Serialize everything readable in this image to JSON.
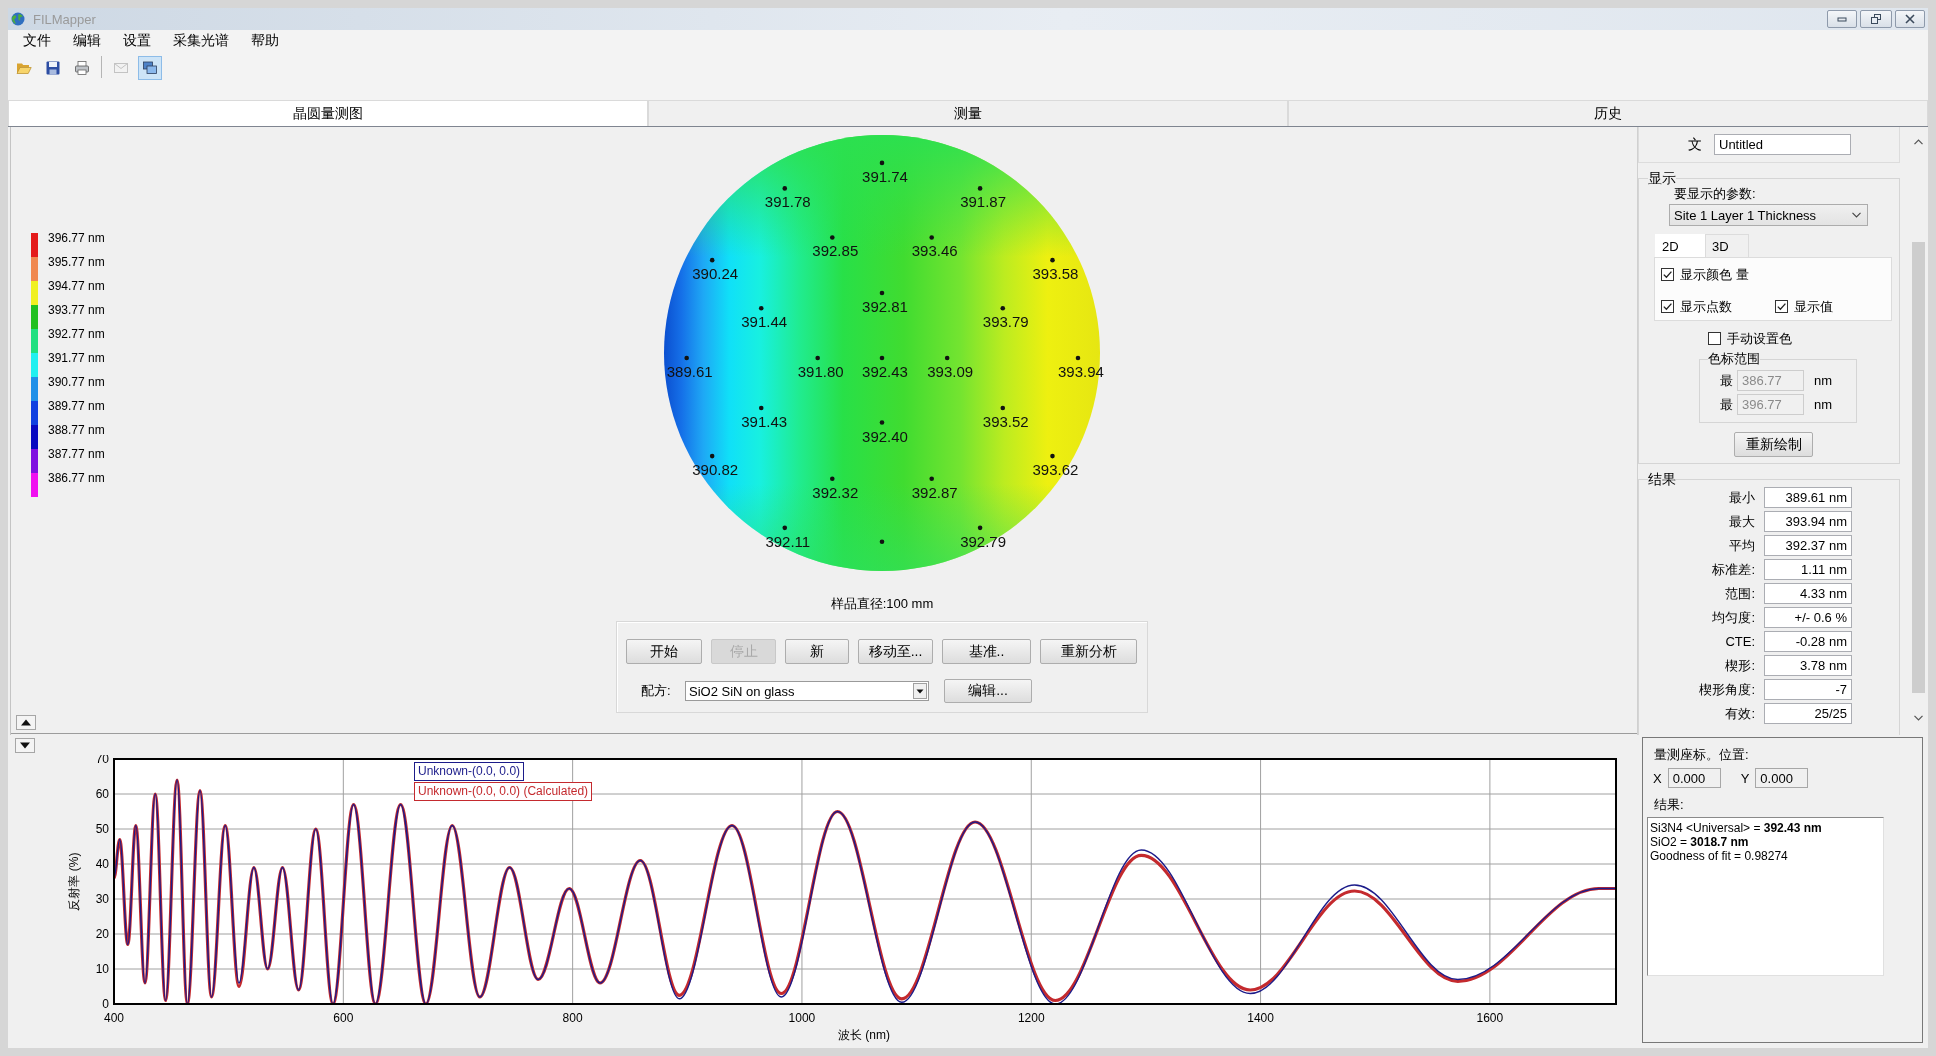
{
  "window": {
    "title": "FILMapper"
  },
  "menu": [
    "文件",
    "编辑",
    "设置",
    "采集光谱",
    "帮助"
  ],
  "toolbar": {
    "groups": [
      [
        {
          "disabled": false,
          "pressed": false
        },
        {
          "disabled": false,
          "pressed": false
        },
        {
          "disabled": false,
          "pressed": false
        }
      ],
      [
        {
          "disabled": true,
          "pressed": false
        },
        {
          "disabled": false,
          "pressed": true
        }
      ]
    ]
  },
  "tabs": [
    {
      "label": "晶圆量测图",
      "selected": true
    },
    {
      "label": "测量",
      "selected": false
    },
    {
      "label": "历史",
      "selected": false
    }
  ],
  "wafer_map": {
    "legend": [
      {
        "label": "396.77 nm",
        "color": "#e41a1a"
      },
      {
        "label": "395.77 nm",
        "color": "#f08850"
      },
      {
        "label": "394.77 nm",
        "color": "#f0f020"
      },
      {
        "label": "393.77 nm",
        "color": "#20c020"
      },
      {
        "label": "392.77 nm",
        "color": "#20e080"
      },
      {
        "label": "391.77 nm",
        "color": "#20f0f0"
      },
      {
        "label": "390.77 nm",
        "color": "#2090e8"
      },
      {
        "label": "389.77 nm",
        "color": "#1040e0"
      },
      {
        "label": "388.77 nm",
        "color": "#0808c0"
      },
      {
        "label": "387.77 nm",
        "color": "#8010e0"
      },
      {
        "label": "386.77 nm",
        "color": "#f010f0"
      }
    ],
    "sites": [
      {
        "kind": "labeled",
        "value": "391.74"
      },
      {
        "kind": "labeled",
        "value": "391.78"
      },
      {
        "kind": "labeled",
        "value": "391.87"
      },
      {
        "kind": "labeled",
        "value": "392.85"
      },
      {
        "kind": "labeled",
        "value": "393.46"
      },
      {
        "kind": "labeled",
        "value": "390.24"
      },
      {
        "kind": "labeled",
        "value": "393.58"
      },
      {
        "kind": "labeled",
        "value": "392.81"
      },
      {
        "kind": "labeled",
        "value": "391.44"
      },
      {
        "kind": "labeled",
        "value": "393.79"
      },
      {
        "kind": "labeled",
        "value": "389.61"
      },
      {
        "kind": "labeled",
        "value": "391.80"
      },
      {
        "kind": "labeled",
        "value": "392.43"
      },
      {
        "kind": "labeled",
        "value": "393.09"
      },
      {
        "kind": "labeled",
        "value": "393.94"
      },
      {
        "kind": "labeled",
        "value": "391.43"
      },
      {
        "kind": "labeled",
        "value": "393.52"
      },
      {
        "kind": "labeled",
        "value": "392.40"
      },
      {
        "kind": "labeled",
        "value": "390.82"
      },
      {
        "kind": "labeled",
        "value": "393.62"
      },
      {
        "kind": "labeled",
        "value": "392.32"
      },
      {
        "kind": "labeled",
        "value": "392.87"
      },
      {
        "kind": "labeled",
        "value": "392.11"
      },
      {
        "kind": "unlabeled"
      },
      {
        "kind": "labeled",
        "value": "392.79"
      }
    ],
    "diameter": "样品直径:100 mm",
    "buttons": [
      {
        "label": "开始",
        "disabled": false
      },
      {
        "label": "停止",
        "disabled": true
      },
      {
        "label": "新",
        "disabled": false
      },
      {
        "label": "移动至...",
        "disabled": false
      },
      {
        "label": "基准..",
        "disabled": false
      },
      {
        "label": "重新分析",
        "disabled": false
      }
    ],
    "recipe": {
      "label": "配方:",
      "value": "SiO2 SiN on glass"
    },
    "edit_button": "编辑..."
  },
  "properties": {
    "document": {
      "label": "文",
      "value": "Untitled"
    },
    "display": {
      "title": "显示",
      "param_label": "要显示的参数:",
      "param_value": "Site 1 Layer 1 Thickness",
      "view_tabs": [
        {
          "label": "2D",
          "selected": true
        },
        {
          "label": "3D",
          "selected": false
        }
      ],
      "options": [
        {
          "label": "显示颜色 量",
          "checked": true
        },
        {
          "label": "显示点数",
          "checked": true
        },
        {
          "label": "显示值",
          "checked": true
        }
      ],
      "manual_color": {
        "label": "手动设置色",
        "checked": false
      },
      "color_range": {
        "title": "色标范围",
        "disabled": true,
        "rows": [
          {
            "label": "最",
            "value": "386.77",
            "unit": "nm"
          },
          {
            "label": "最",
            "value": "396.77",
            "unit": "nm"
          }
        ]
      },
      "redraw_button": "重新绘制"
    },
    "results": {
      "title": "结果",
      "rows": [
        {
          "label": "最小",
          "value": "389.61 nm"
        },
        {
          "label": "最大",
          "value": "393.94 nm"
        },
        {
          "label": "平均",
          "value": "392.37 nm"
        },
        {
          "label": "标准差:",
          "value": "1.11 nm"
        },
        {
          "label": "范围:",
          "value": "4.33 nm"
        },
        {
          "label": "均匀度:",
          "value": "+/- 0.6 %"
        },
        {
          "label": "CTE:",
          "value": "-0.28 nm"
        },
        {
          "label": "楔形:",
          "value": "3.78 nm"
        },
        {
          "label": "楔形角度:",
          "value": "-7"
        },
        {
          "label": "有效:",
          "value": "25/25"
        }
      ]
    }
  },
  "spectrum": {
    "chart_data": {
      "type": "line",
      "xlabel": "波长 (nm)",
      "ylabel": "反射率 (%)",
      "x": [
        400,
        405,
        412,
        419,
        427,
        436,
        445,
        455,
        464,
        475,
        485,
        497,
        509,
        522,
        534,
        547,
        561,
        576,
        591,
        609,
        628,
        650,
        672,
        695,
        719,
        745,
        770,
        797,
        824,
        859,
        893,
        939,
        982,
        1031,
        1087,
        1151,
        1221,
        1296,
        1391,
        1482,
        1572,
        1695,
        1710
      ],
      "series": [
        {
          "name": "Unknown-(0.0, 0.0)",
          "color": "#1c1c8a",
          "values": [
            36,
            47,
            17,
            51,
            6,
            60,
            1,
            64,
            0,
            61,
            2,
            51,
            6,
            39,
            10,
            39,
            4,
            50,
            0,
            57,
            0,
            57,
            0,
            51,
            2,
            39,
            7,
            33,
            6,
            41,
            1.5,
            51,
            2,
            55,
            0.5,
            52,
            0,
            44,
            3,
            34,
            7,
            33,
            33
          ]
        },
        {
          "name": "Unknown-(0.0, 0.0) (Calculated)",
          "color": "#c42a2e",
          "values": [
            36,
            47,
            17,
            51,
            6,
            60,
            1,
            64,
            0,
            61,
            2,
            51,
            5,
            39,
            10,
            39,
            4,
            50,
            0,
            57,
            0,
            57,
            0,
            51,
            2,
            39,
            7,
            33,
            6,
            41,
            2.5,
            51,
            3,
            55,
            1.5,
            52,
            1,
            42.5,
            4,
            32.3,
            6.5,
            33,
            33
          ]
        }
      ],
      "xlim": [
        400,
        1710
      ],
      "ylim": [
        0,
        70
      ],
      "xticks": [
        400,
        600,
        800,
        1000,
        1200,
        1400,
        1600
      ],
      "yticks": [
        0,
        10,
        20,
        30,
        40,
        50,
        60,
        70
      ],
      "grid": true
    }
  },
  "fit": {
    "position_label": "量测座标。位置:",
    "x": {
      "label": "X",
      "value": "0.000"
    },
    "y": {
      "label": "Y",
      "value": "0.000"
    },
    "results_label": "结果:",
    "lines": [
      "Si3N4 <Universal> = **392.43 nm**",
      "SiO2 = **3018.7 nm**",
      "Goodness of fit = 0.98274"
    ]
  }
}
